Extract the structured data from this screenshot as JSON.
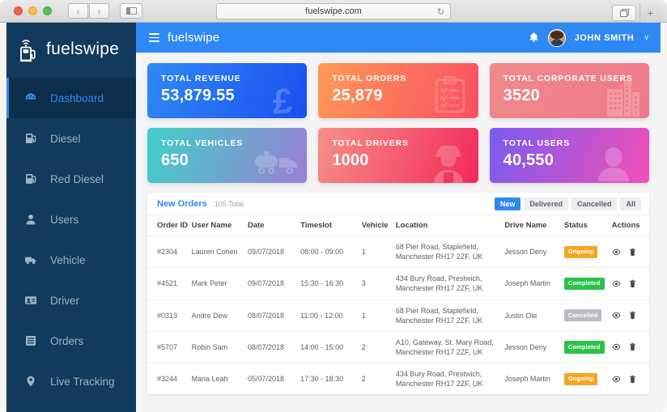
{
  "browser": {
    "url": "fuelswipe.com",
    "back_label": "‹",
    "forward_label": "›",
    "reload_label": "↻",
    "new_tab_label": "+"
  },
  "sidebar": {
    "brand": "fuelswipe",
    "brand_icon": "fuel-pump-wifi-icon",
    "items": [
      {
        "label": "Dashboard",
        "icon": "dashboard-gauge-icon",
        "active": true
      },
      {
        "label": "Diesel",
        "icon": "fuel-pump-icon",
        "active": false
      },
      {
        "label": "Red Diesel",
        "icon": "fuel-pump-icon",
        "active": false
      },
      {
        "label": "Users",
        "icon": "user-icon",
        "active": false
      },
      {
        "label": "Vehicle",
        "icon": "truck-icon",
        "active": false
      },
      {
        "label": "Driver",
        "icon": "id-card-icon",
        "active": false
      },
      {
        "label": "Orders",
        "icon": "list-icon",
        "active": false
      },
      {
        "label": "Live Tracking",
        "icon": "map-pin-icon",
        "active": false
      }
    ]
  },
  "topbar": {
    "menu_icon": "hamburger-icon",
    "brand": "fuelswipe",
    "bell_icon": "bell-icon",
    "avatar_icon": "user-avatar",
    "username": "JOHN SMITH",
    "caret": "∨"
  },
  "cards": [
    {
      "label": "TOTAL REVENUE",
      "value": "53,879.55",
      "icon": "pound-sterling-icon",
      "color_from": "#2f89f4",
      "color_to": "#1a4ef0"
    },
    {
      "label": "TOTAL ORDERS",
      "value": "25,879",
      "icon": "clipboard-check-icon",
      "color_from": "#ff9a56",
      "color_to": "#f94f63"
    },
    {
      "label": "TOTAL CORPORATE USERS",
      "value": "3520",
      "icon": "buildings-icon",
      "color_from": "#ef8a8a",
      "color_to": "#f17b88"
    },
    {
      "label": "TOTAL VEHICLES",
      "value": "650",
      "icon": "tanker-truck-icon",
      "color_from": "#3fd0c9",
      "color_to": "#9b7fd4"
    },
    {
      "label": "TOTAL DRIVERS",
      "value": "1000",
      "icon": "driver-person-icon",
      "color_from": "#f79087",
      "color_to": "#f2295b"
    },
    {
      "label": "TOTAL USERS",
      "value": "40,550",
      "icon": "user-silhouette-icon",
      "color_from": "#7a5cf0",
      "color_to": "#f24fb8"
    }
  ],
  "orders_panel": {
    "title": "New Orders",
    "subtitle": "105 Total",
    "filters": [
      {
        "label": "New",
        "active": true
      },
      {
        "label": "Delivered",
        "active": false
      },
      {
        "label": "Cancelled",
        "active": false
      },
      {
        "label": "All",
        "active": false
      }
    ],
    "columns": [
      "Order ID",
      "User Name",
      "Date",
      "Timeslot",
      "Vehicle",
      "Location",
      "Drive Name",
      "Status",
      "Actions"
    ],
    "rows": [
      {
        "order_id": "#2304",
        "user_name": "Lauren Cohen",
        "date": "09/07/2018",
        "timeslot": "08:00 - 09:00",
        "vehicle": "1",
        "location": "68  Pier Road, Staplefield, Manchester RH17 2ZF, UK",
        "drive_name": "Jesson Deny",
        "status": "Ongoing",
        "status_kind": "ongoing",
        "actions": [
          "view-icon",
          "delete-icon"
        ]
      },
      {
        "order_id": "#4521",
        "user_name": "Mark Peter",
        "date": "09/07/2018",
        "timeslot": "15:30 - 16:30",
        "vehicle": "3",
        "location": "434 Bury Road, Prestwich, Manchester RH17 2ZF, UK",
        "drive_name": "Joseph Martin",
        "status": "Completed",
        "status_kind": "completed",
        "actions": [
          "view-icon",
          "delete-icon"
        ]
      },
      {
        "order_id": "#0313",
        "user_name": "Andre Dew",
        "date": "08/07/2018",
        "timeslot": "11:00 - 12:00",
        "vehicle": "1",
        "location": "68  Pier Road, Staplefield, Manchester RH17 2ZF, UK",
        "drive_name": "Justin Ole",
        "status": "Cancelled",
        "status_kind": "cancelled",
        "actions": [
          "view-icon",
          "delete-icon"
        ]
      },
      {
        "order_id": "#5707",
        "user_name": "Robin Sam",
        "date": "08/07/2018",
        "timeslot": "14:00 - 15:00",
        "vehicle": "2",
        "location": "A10, Gateway, St. Mary Road, Manchester RH17 2ZF, UK",
        "drive_name": "Jesson Deny",
        "status": "Completed",
        "status_kind": "completed",
        "actions": [
          "view-icon",
          "delete-icon"
        ]
      },
      {
        "order_id": "#3244",
        "user_name": "Maria Leah",
        "date": "05/07/2018",
        "timeslot": "17:30 - 18:30",
        "vehicle": "2",
        "location": "434 Bury Road, Prestwich, Manchester RH17 2ZF, UK",
        "drive_name": "Joseph Martin",
        "status": "Ongoing",
        "status_kind": "ongoing",
        "actions": [
          "view-icon",
          "delete-icon"
        ]
      }
    ]
  }
}
